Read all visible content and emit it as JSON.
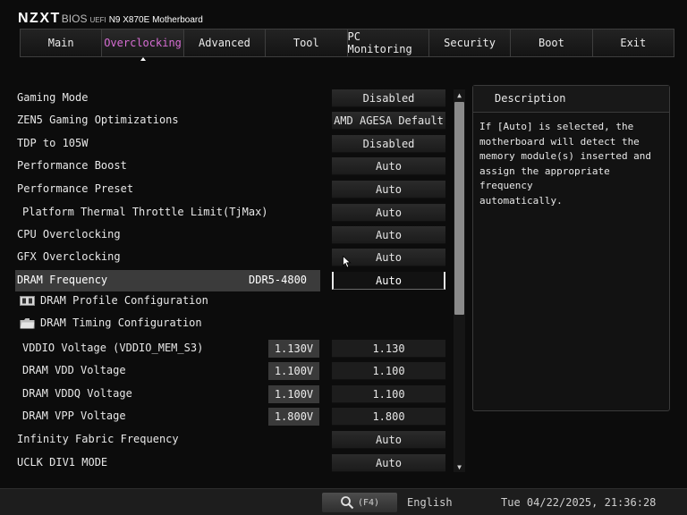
{
  "header": {
    "brand": "NZXT",
    "bios": "BIOS",
    "uefi": "UEFI",
    "model": "N9 X870E Motherboard"
  },
  "tabs": [
    {
      "label": "Main",
      "active": false
    },
    {
      "label": "Overclocking",
      "active": true
    },
    {
      "label": "Advanced",
      "active": false
    },
    {
      "label": "Tool",
      "active": false
    },
    {
      "label": "PC Monitoring",
      "active": false
    },
    {
      "label": "Security",
      "active": false
    },
    {
      "label": "Boot",
      "active": false
    },
    {
      "label": "Exit",
      "active": false
    }
  ],
  "settings": [
    {
      "label": "Gaming Mode",
      "value": "Disabled"
    },
    {
      "label": "ZEN5 Gaming Optimizations",
      "value": "AMD AGESA Default"
    },
    {
      "label": "TDP to 105W",
      "value": "Disabled"
    },
    {
      "label": "Performance Boost",
      "value": "Auto"
    },
    {
      "label": "Performance Preset",
      "value": "Auto"
    },
    {
      "label": "Platform Thermal Throttle Limit(TjMax)",
      "value": "Auto"
    },
    {
      "label": "CPU Overclocking",
      "value": "Auto"
    },
    {
      "label": "GFX Overclocking",
      "value": "Auto"
    },
    {
      "label": "DRAM Frequency",
      "current": "DDR5-4800",
      "value": "Auto"
    },
    {
      "label": "DRAM Profile Configuration",
      "icon": "memory-module-icon"
    },
    {
      "label": "DRAM Timing Configuration",
      "icon": "folder-icon"
    },
    {
      "label": "VDDIO Voltage (VDDIO_MEM_S3)",
      "current": "1.130V",
      "value": "1.130"
    },
    {
      "label": "DRAM VDD Voltage",
      "current": "1.100V",
      "value": "1.100"
    },
    {
      "label": "DRAM VDDQ Voltage",
      "current": "1.100V",
      "value": "1.100"
    },
    {
      "label": "DRAM VPP Voltage",
      "current": "1.800V",
      "value": "1.800"
    },
    {
      "label": "Infinity Fabric Frequency",
      "value": "Auto"
    },
    {
      "label": "UCLK DIV1 MODE",
      "value": "Auto"
    }
  ],
  "selected_setting": "DRAM Frequency",
  "description": {
    "title": "Description",
    "lines": [
      "If [Auto] is selected, the",
      "motherboard will detect the",
      "memory module(s) inserted and",
      "assign the appropriate frequency",
      "automatically."
    ]
  },
  "footer": {
    "search_key": "(F4)",
    "language": "English",
    "datetime": "Tue 04/22/2025, 21:36:28"
  },
  "colors": {
    "accent": "#d76dd4",
    "background": "#0c0c0c",
    "row_highlight": "#3b3b3b"
  }
}
